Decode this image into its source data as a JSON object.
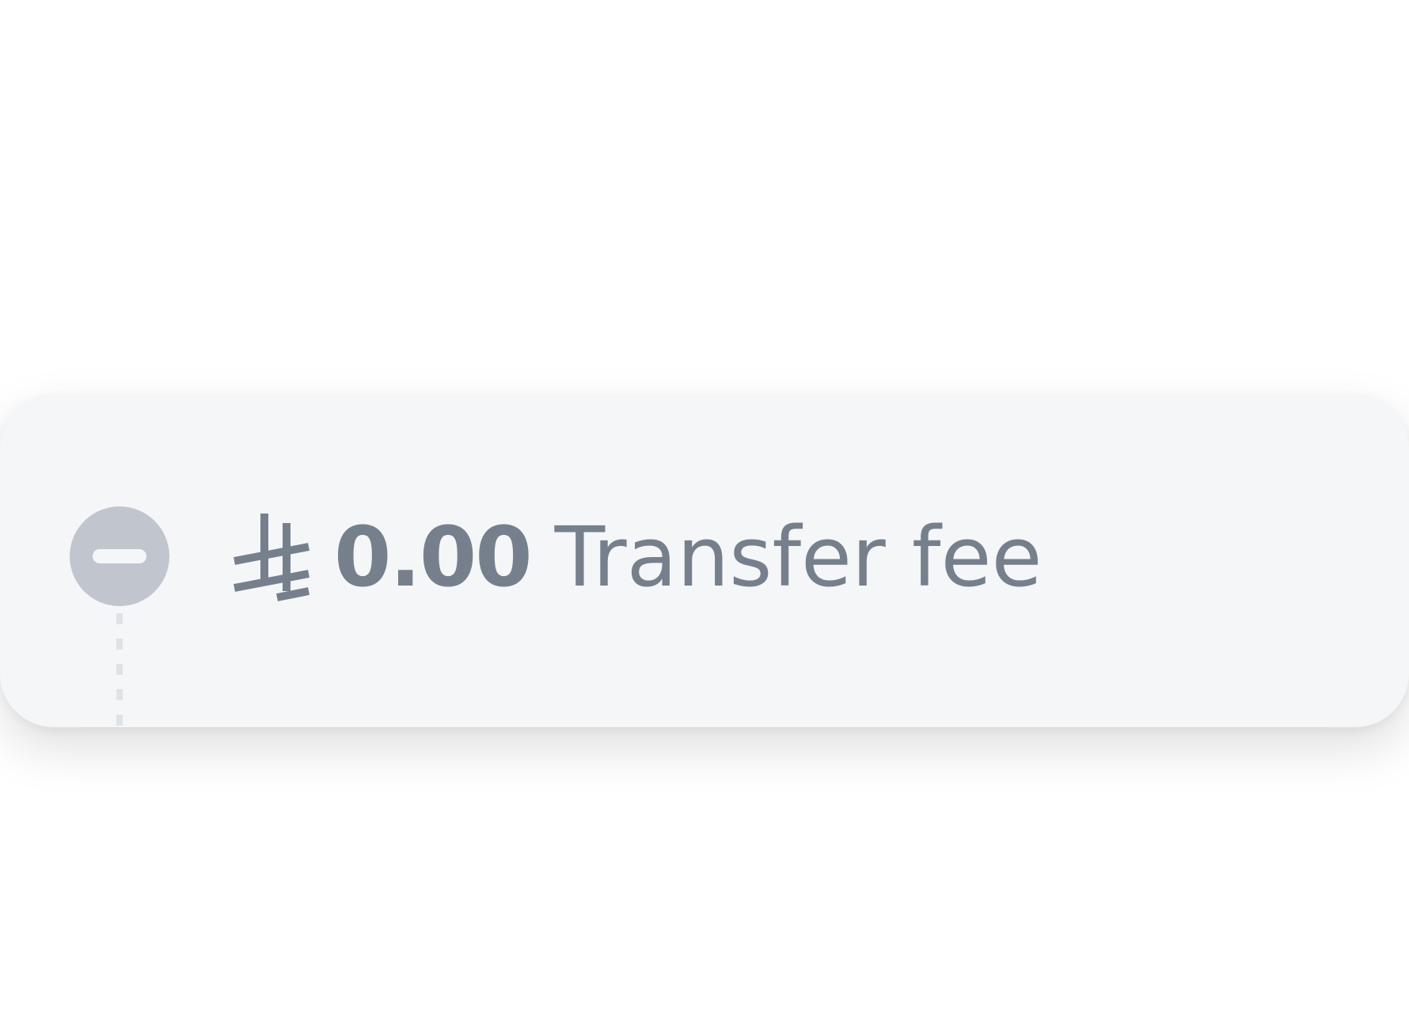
{
  "fee_item": {
    "currency_icon": "hbar-currency-icon",
    "amount": "0.00",
    "label": "Transfer fee",
    "status_icon": "minus-circle-icon"
  },
  "colors": {
    "card_background": "#f5f6f8",
    "text": "#76808d",
    "status_circle": "#c1c6ce",
    "connector": "#dfe2e6"
  }
}
